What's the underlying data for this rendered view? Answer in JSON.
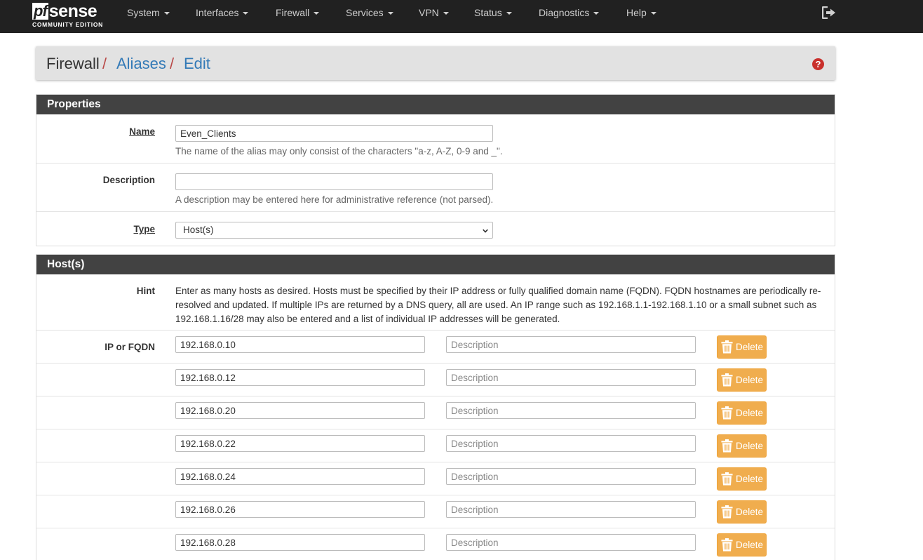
{
  "navbar": {
    "logo": {
      "pf": "pf",
      "sense": "sense",
      "edition": "COMMUNITY EDITION"
    },
    "menu": [
      {
        "label": "System"
      },
      {
        "label": "Interfaces"
      },
      {
        "label": "Firewall"
      },
      {
        "label": "Services"
      },
      {
        "label": "VPN"
      },
      {
        "label": "Status"
      },
      {
        "label": "Diagnostics"
      },
      {
        "label": "Help"
      }
    ],
    "logout_icon": "sign-out-icon"
  },
  "breadcrumb": {
    "root": "Firewall",
    "sep": "/",
    "aliases": "Aliases",
    "edit": "Edit",
    "help_icon": "question-circle-icon",
    "help_glyph": "?"
  },
  "properties": {
    "heading": "Properties",
    "name": {
      "label": "Name",
      "value": "Even_Clients",
      "help": "The name of the alias may only consist of the characters \"a-z, A-Z, 0-9 and _\"."
    },
    "description": {
      "label": "Description",
      "value": "",
      "help": "A description may be entered here for administrative reference (not parsed)."
    },
    "type": {
      "label": "Type",
      "selected": "Host(s)"
    }
  },
  "hosts": {
    "heading": "Host(s)",
    "hint_label": "Hint",
    "hint": "Enter as many hosts as desired. Hosts must be specified by their IP address or fully qualified domain name (FQDN). FQDN hostnames are periodically re-resolved and updated. If multiple IPs are returned by a DNS query, all are used. An IP range such as 192.168.1.1-192.168.1.10 or a small subnet such as 192.168.1.16/28 may also be entered and a list of individual IP addresses will be generated.",
    "ip_label": "IP or FQDN",
    "desc_placeholder": "Description",
    "delete_label": "Delete",
    "delete_icon": "trash-icon",
    "entries": [
      {
        "ip": "192.168.0.10",
        "description": ""
      },
      {
        "ip": "192.168.0.12",
        "description": ""
      },
      {
        "ip": "192.168.0.20",
        "description": ""
      },
      {
        "ip": "192.168.0.22",
        "description": ""
      },
      {
        "ip": "192.168.0.24",
        "description": ""
      },
      {
        "ip": "192.168.0.26",
        "description": ""
      },
      {
        "ip": "192.168.0.28",
        "description": ""
      }
    ]
  },
  "colors": {
    "navbar_bg": "#212121",
    "panel_heading_bg": "#424242",
    "link": "#337ab7",
    "breadcrumb_sep": "#b94a48",
    "delete_button": "#f0ad4e",
    "help_icon": "#c9302c"
  }
}
